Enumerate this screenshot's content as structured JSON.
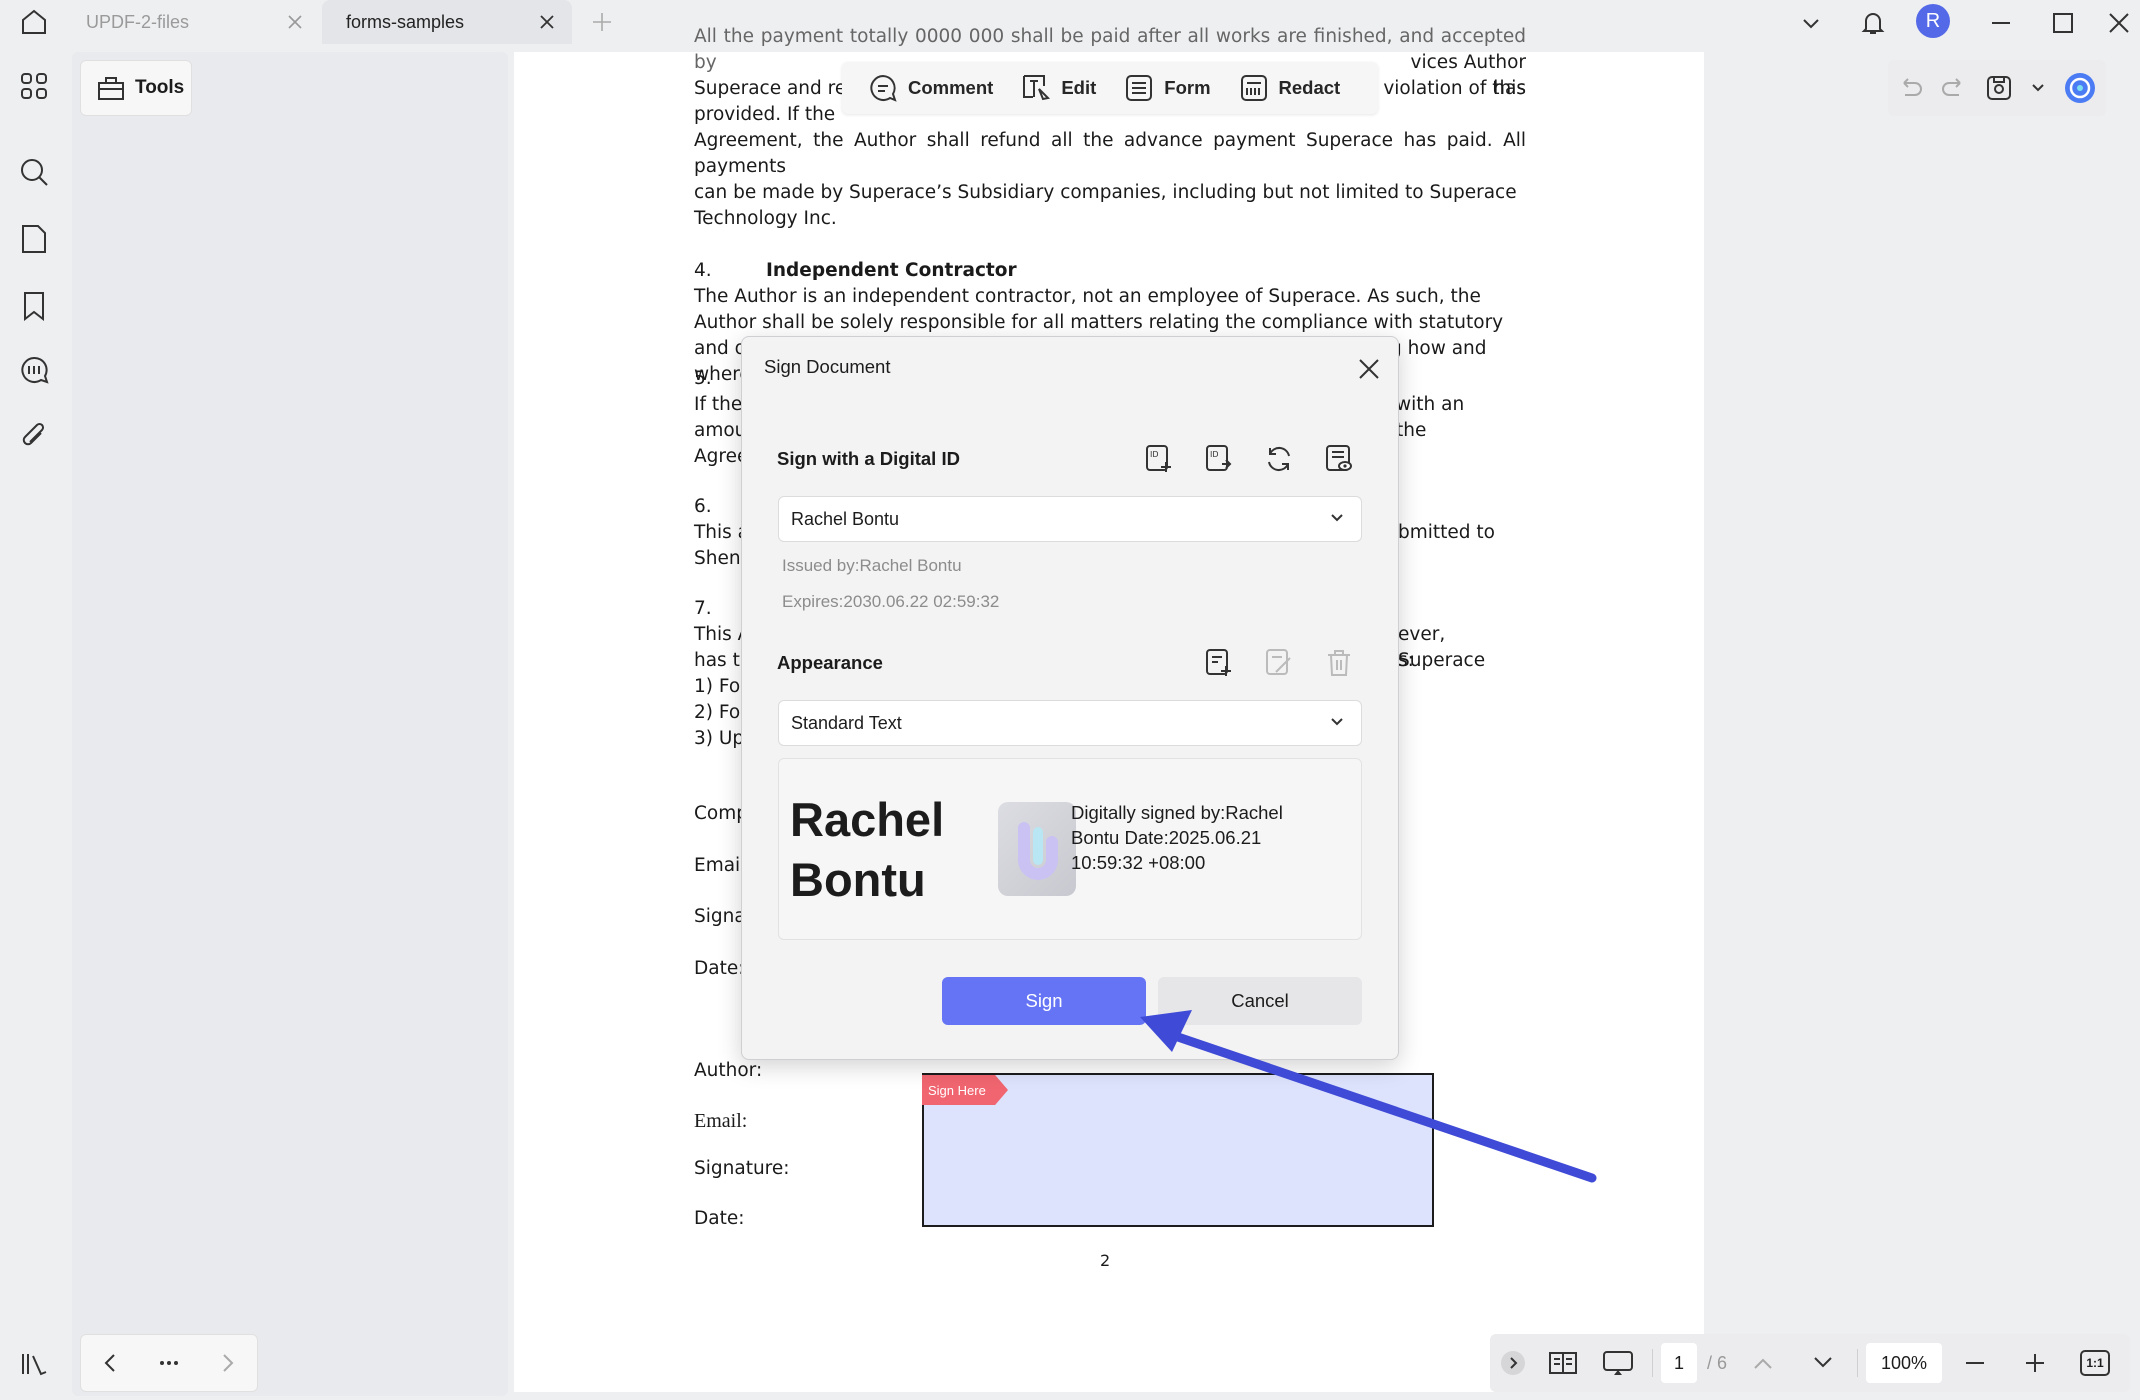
{
  "tabs": [
    {
      "label": "UPDF-2-files",
      "active": false
    },
    {
      "label": "forms-samples",
      "active": true
    }
  ],
  "window": {
    "avatar_letter": "R"
  },
  "tools": {
    "label": "Tools"
  },
  "toolbar": {
    "comment": "Comment",
    "edit": "Edit",
    "form": "Form",
    "redact": "Redact"
  },
  "document": {
    "lines_top": [
      "All the payment totally 0000 000 shall be paid after all works are finished, and accepted by",
      "Superace and rec",
      "vices Author has",
      "provided. If the",
      "violation of this",
      "Agreement, the Author shall refund all the advance payment Superace has paid. All payments",
      "can be made by Superace’s Subsidiary companies, including but not limited to Superace",
      "Technology Inc."
    ],
    "s4_num": "4.",
    "s4_title": "Independent Contractor",
    "s4_text": "The Author is an independent contractor, not an employee of Superace. As such, the Author shall be solely responsible for all matters relating the compliance with statutory and other legal obligations arising from these responsibilities in determining how and where the Works set forth in this Agreement is to be performed.",
    "s5_num": "5.",
    "s5_l1a": "If the",
    "s5_l1b": "with an",
    "s5_l2a": "amou",
    "s5_l2b": "the",
    "s5_l3a": "Agree",
    "s6_num": "6.",
    "s6_l1a": "This a",
    "s6_l1b": "bmitted to",
    "s6_l2a": "Shenz",
    "s7_num": "7.",
    "s7_l1a": "This A",
    "s7_l1b": "ever, Superace",
    "s7_l2a": "has th",
    "s7_l2b": "s:",
    "s7_l3": "1) For",
    "s7_l4": "2) For",
    "s7_l5": "3)  Up",
    "comp": "Comp",
    "email_a": "Email",
    "signa": "Signa",
    "date_a": "Date:",
    "author": "Author:",
    "email_b": "Email:",
    "signature_b": "Signature:",
    "date_b": "Date:",
    "page_number": "2",
    "sign_here": "Sign Here"
  },
  "dialog": {
    "title": "Sign Document",
    "digital_id_heading": "Sign with a Digital ID",
    "selected_id": "Rachel Bontu",
    "issued_by": "Issued by:Rachel Bontu",
    "expires": "Expires:2030.06.22 02:59:32",
    "appearance_heading": "Appearance",
    "appearance_value": "Standard Text",
    "preview_name_line1": "Rachel",
    "preview_name_line2": "Bontu",
    "preview_info": "Digitally signed by:Rachel Bontu Date:2025.06.21 10:59:32 +08:00",
    "sign_button": "Sign",
    "cancel_button": "Cancel"
  },
  "pager": {
    "current_page": "1",
    "total_pages": "/ 6",
    "zoom": "100%",
    "fit_label": "1:1"
  },
  "colors": {
    "accent": "#6474f4",
    "avatar": "#5469e8",
    "signature_field": "#dde3fd",
    "sign_here_tag": "#f06570",
    "annotation_arrow": "#3f4bd6"
  }
}
